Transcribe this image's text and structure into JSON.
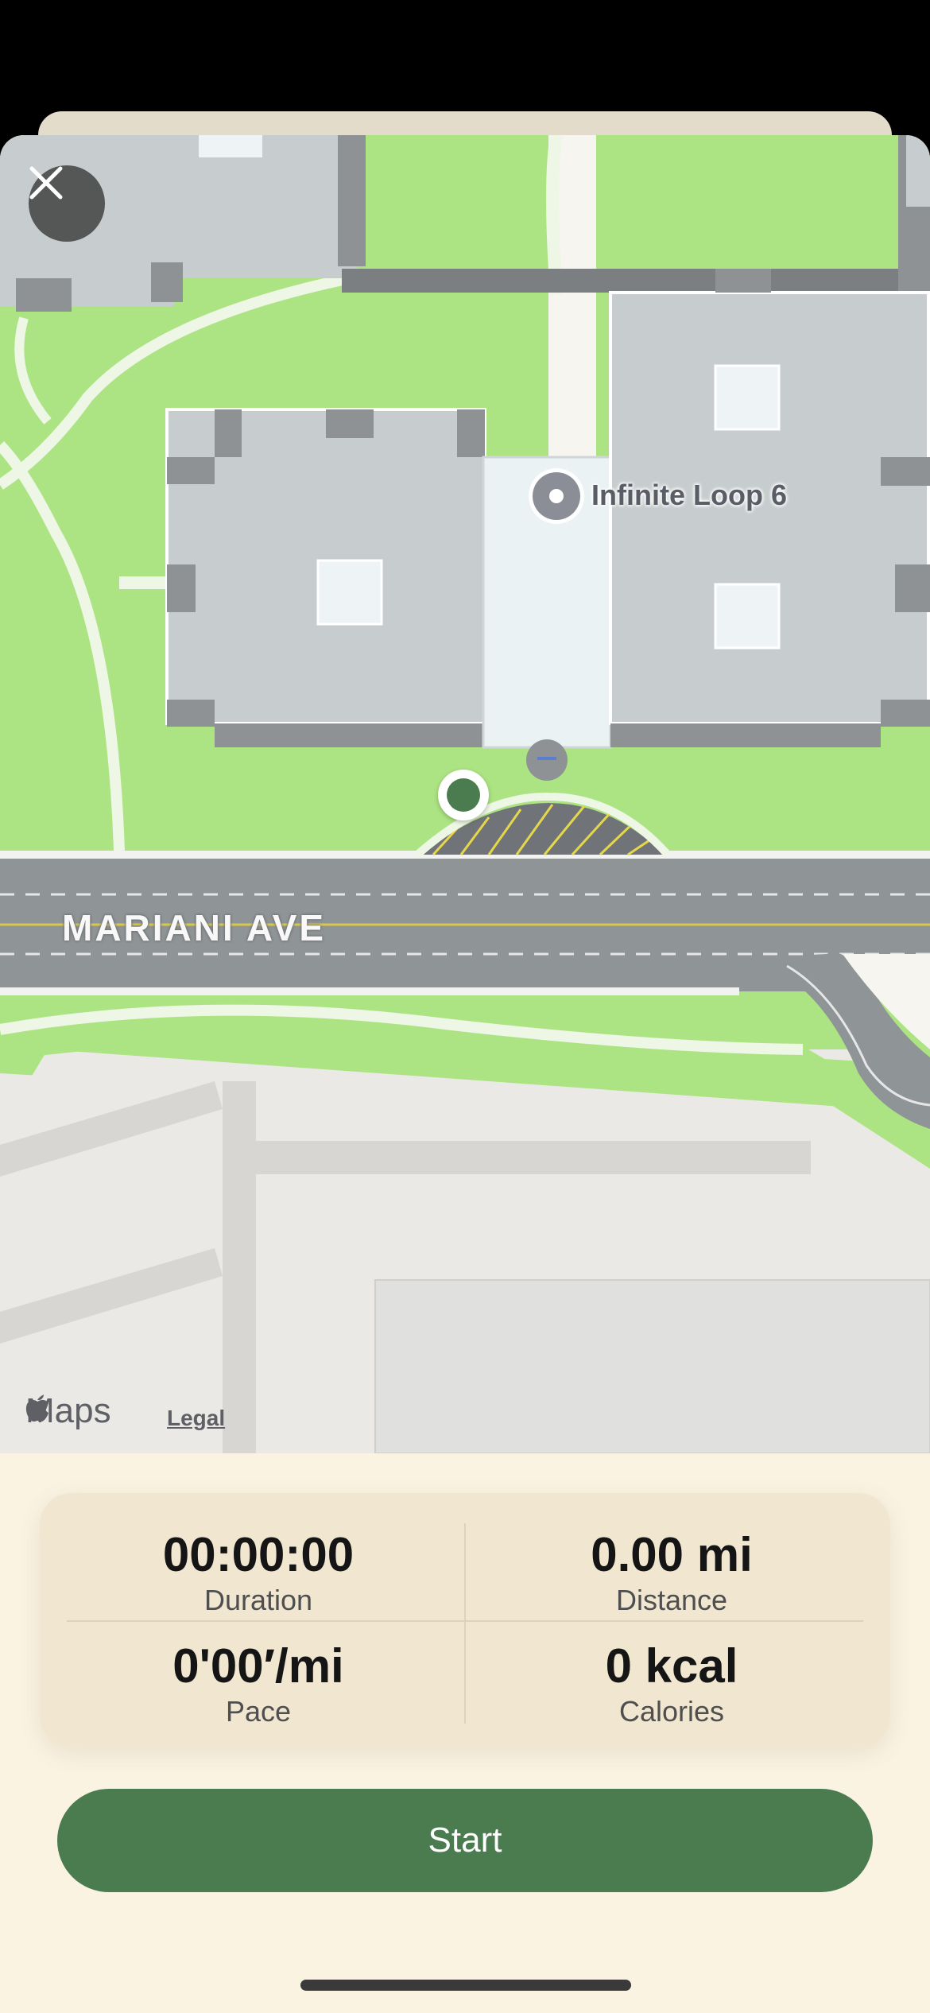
{
  "map": {
    "poi_label": "Infinite Loop 6",
    "street_label": "MARIANI AVE",
    "attribution_brand": "Maps",
    "legal_link": "Legal"
  },
  "workout_stats": {
    "duration": {
      "value": "00:00:00",
      "label": "Duration"
    },
    "distance": {
      "value": "0.00 mi",
      "label": "Distance"
    },
    "pace": {
      "value": "0'00′/mi",
      "label": "Pace"
    },
    "calories": {
      "value": "0 kcal",
      "label": "Calories"
    }
  },
  "actions": {
    "start_label": "Start"
  },
  "icons": {
    "close": "close-icon",
    "apple_logo": "apple-logo-icon",
    "poi": "poi-pin-icon",
    "user_location": "current-location-icon"
  },
  "colors": {
    "accent": "#4a7c50",
    "background": "#faf3e2",
    "stats_card": "#f1e6d0",
    "grass": "#ade483",
    "building": "#c7cdce",
    "road": "#8f9496"
  }
}
